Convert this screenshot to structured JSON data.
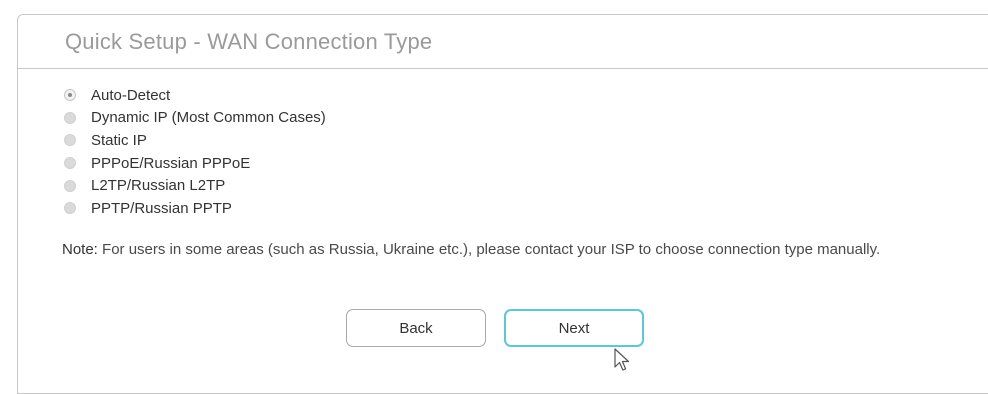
{
  "panel": {
    "title": "Quick Setup - WAN Connection Type"
  },
  "options": [
    {
      "label": "Auto-Detect",
      "selected": true
    },
    {
      "label": "Dynamic IP (Most Common Cases)",
      "selected": false
    },
    {
      "label": "Static IP",
      "selected": false
    },
    {
      "label": "PPPoE/Russian PPPoE",
      "selected": false
    },
    {
      "label": "L2TP/Russian L2TP",
      "selected": false
    },
    {
      "label": "PPTP/Russian PPTP",
      "selected": false
    }
  ],
  "note": {
    "label": "Note:",
    "text": " For users in some areas (such as Russia, Ukraine etc.), please contact your ISP to choose connection type manually."
  },
  "buttons": {
    "back_label": "Back",
    "next_label": "Next"
  },
  "colors": {
    "accent": "#5ec6d4",
    "border": "#c8c8c8",
    "title": "#9a9a9a"
  },
  "icons": {
    "cursor": "mouse-pointer-icon"
  }
}
